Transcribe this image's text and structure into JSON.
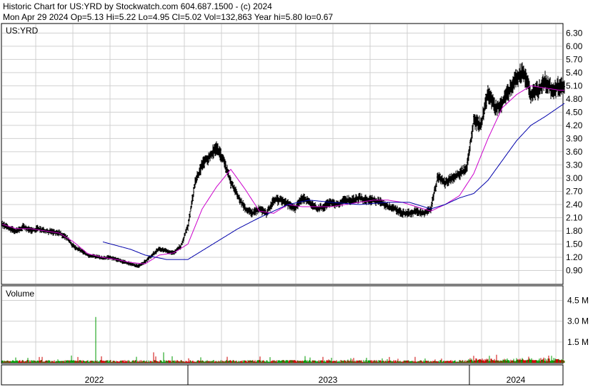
{
  "header": {
    "line1": "Historic Chart for US:YRD by Stockwatch.com 604.687.1500 - (c) 2024",
    "line2": "Mon Apr 29 2024  Op=5.13  Hi=5.22  Lo=4.95  Cl=5.02  Vol=132,863  Year hi=5.80  lo=0.67"
  },
  "price_panel": {
    "label": "US:YRD"
  },
  "volume_panel": {
    "label": "Volume"
  },
  "colors": {
    "bars": "#000000",
    "ma_short": "#cc00cc",
    "ma_long": "#0000aa",
    "vol_up": "#009900",
    "vol_down": "#cc0000",
    "grid": "#d0d0d0"
  },
  "chart_data": [
    {
      "type": "ohlc",
      "title": "Historic Chart for US:YRD",
      "symbol": "US:YRD",
      "ylim": [
        0.6,
        6.5
      ],
      "y_ticks": [
        "0.90",
        "1.20",
        "1.50",
        "1.80",
        "2.10",
        "2.40",
        "2.70",
        "3.00",
        "3.30",
        "3.60",
        "3.90",
        "4.20",
        "4.50",
        "4.80",
        "5.10",
        "5.40",
        "5.70",
        "6.00",
        "6.30"
      ],
      "x_period_labels": [
        "2022",
        "2023",
        "2024"
      ],
      "grid": true,
      "series": [
        {
          "name": "Close",
          "x_index": [
            0,
            10,
            20,
            30,
            40,
            50,
            60,
            70,
            80,
            90,
            100,
            110,
            120,
            130,
            140,
            150,
            160,
            170,
            180,
            190,
            200,
            210,
            220,
            230,
            240,
            250,
            260,
            270,
            280,
            290,
            300,
            310,
            320,
            330,
            340,
            350,
            360,
            370,
            380,
            390,
            400,
            410,
            420,
            430,
            440,
            450,
            460,
            470,
            480,
            490,
            500,
            510,
            520,
            530,
            540,
            550,
            560,
            570,
            580,
            590,
            600,
            610,
            620,
            630,
            640,
            650,
            660,
            670,
            680,
            690,
            700,
            710,
            720,
            730,
            740,
            750,
            760,
            770,
            780,
            787
          ],
          "values": [
            1.95,
            1.85,
            1.8,
            1.9,
            1.8,
            1.85,
            1.8,
            1.78,
            1.75,
            1.65,
            1.45,
            1.35,
            1.25,
            1.22,
            1.18,
            1.2,
            1.15,
            1.1,
            1.05,
            1.0,
            1.1,
            1.25,
            1.4,
            1.35,
            1.3,
            1.45,
            1.9,
            2.9,
            3.3,
            3.5,
            3.7,
            3.4,
            2.9,
            2.6,
            2.3,
            2.2,
            2.3,
            2.2,
            2.5,
            2.5,
            2.4,
            2.3,
            2.55,
            2.45,
            2.3,
            2.35,
            2.45,
            2.4,
            2.5,
            2.5,
            2.55,
            2.5,
            2.5,
            2.45,
            2.35,
            2.3,
            2.2,
            2.2,
            2.25,
            2.2,
            2.3,
            3.05,
            2.9,
            3.0,
            3.1,
            3.2,
            4.3,
            4.2,
            4.9,
            4.6,
            4.7,
            5.0,
            5.3,
            5.4,
            4.9,
            5.0,
            5.2,
            5.0,
            5.1,
            5.02
          ]
        },
        {
          "name": "Short moving average",
          "x_index": [
            0,
            20,
            40,
            60,
            80,
            100,
            120,
            140,
            160,
            180,
            200,
            220,
            240,
            260,
            280,
            300,
            320,
            340,
            360,
            380,
            400,
            420,
            440,
            460,
            480,
            500,
            520,
            540,
            560,
            580,
            600,
            620,
            640,
            660,
            680,
            700,
            720,
            740,
            760,
            780,
            787
          ],
          "values": [
            1.95,
            1.85,
            1.85,
            1.8,
            1.75,
            1.55,
            1.28,
            1.2,
            1.15,
            1.08,
            1.05,
            1.25,
            1.3,
            1.5,
            2.3,
            2.8,
            3.2,
            2.75,
            2.25,
            2.2,
            2.4,
            2.35,
            2.35,
            2.35,
            2.4,
            2.45,
            2.5,
            2.5,
            2.45,
            2.35,
            2.25,
            2.4,
            2.6,
            3.1,
            3.9,
            4.6,
            4.9,
            5.1,
            5.05,
            5.0,
            5.0
          ]
        },
        {
          "name": "Long moving average",
          "x_index": [
            141,
            180,
            200,
            230,
            260,
            300,
            330,
            360,
            400,
            430,
            460,
            500,
            540,
            570,
            600,
            620,
            640,
            660,
            680,
            700,
            720,
            740,
            760,
            787
          ],
          "values": [
            1.55,
            1.38,
            1.25,
            1.15,
            1.15,
            1.55,
            1.85,
            2.1,
            2.4,
            2.5,
            2.45,
            2.4,
            2.45,
            2.45,
            2.3,
            2.4,
            2.55,
            2.65,
            2.95,
            3.4,
            3.85,
            4.2,
            4.4,
            4.7
          ]
        }
      ]
    },
    {
      "type": "bar",
      "title": "Volume",
      "ylim": [
        0,
        5500000
      ],
      "y_ticks": [
        "1.5 M",
        "3.0 M",
        "4.5 M"
      ],
      "y_tick_values": [
        1500000,
        3000000,
        4500000
      ],
      "note_max_spike": {
        "x_index": 131,
        "value": 3300000
      }
    }
  ]
}
